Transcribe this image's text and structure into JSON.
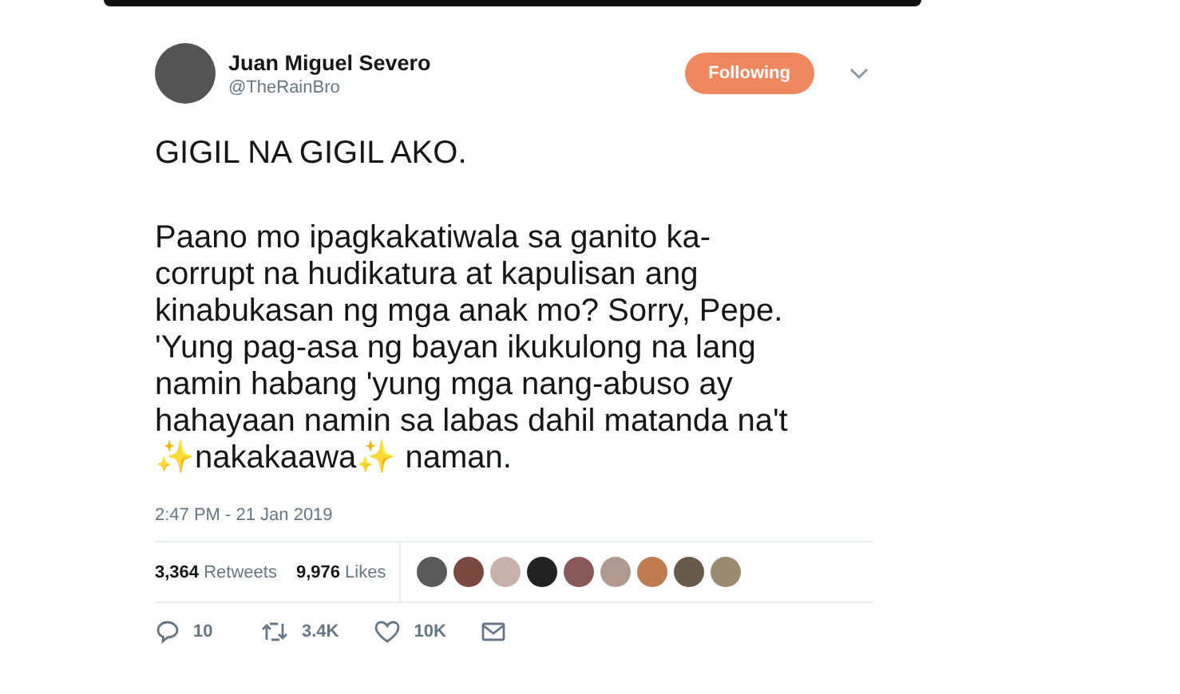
{
  "tweet": {
    "author": {
      "name": "Juan Miguel Severo",
      "handle": "@TheRainBro"
    },
    "follow_button": {
      "label": "Following",
      "selected": true
    },
    "headline": "GIGIL NA GIGIL AKO.",
    "body": "Paano mo ipagkakatiwala sa ganito ka-corrupt na hudikatura at kapulisan ang kinabukasan ng mga anak mo? Sorry, Pepe. 'Yung pag-asa ng bayan ikukulong na lang namin habang 'yung mga nang-abuso ay hahayaan namin sa labas dahil matanda na't ✨nakakaawa✨ naman.",
    "timestamp": "2:47 PM - 21 Jan 2019",
    "stats": [
      {
        "count": "3,364",
        "label": "Retweets"
      },
      {
        "count": "9,976",
        "label": "Likes"
      }
    ],
    "likers": [
      {
        "color": "#5a5a5a"
      },
      {
        "color": "#7a4a40"
      },
      {
        "color": "#c9b0a8"
      },
      {
        "color": "#222222"
      },
      {
        "color": "#8a5a5a"
      },
      {
        "color": "#b09a90"
      },
      {
        "color": "#c07a50"
      },
      {
        "color": "#6a5a4a"
      },
      {
        "color": "#9a8a70"
      }
    ],
    "actions": [
      {
        "kind": "reply",
        "count": "10"
      },
      {
        "kind": "retweet",
        "count": "3.4K"
      },
      {
        "kind": "like",
        "count": "10K"
      },
      {
        "kind": "message"
      }
    ]
  }
}
